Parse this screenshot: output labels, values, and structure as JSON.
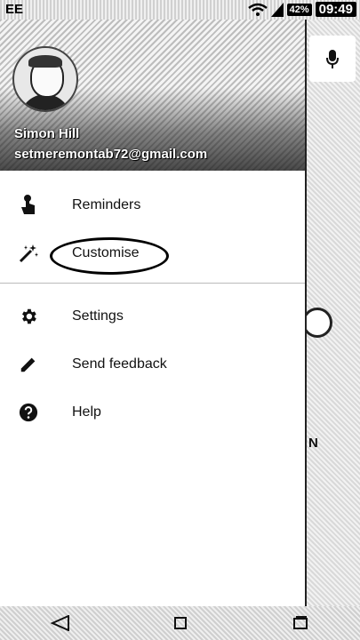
{
  "status_bar": {
    "carrier": "EE",
    "battery": "42%",
    "time": "09:49"
  },
  "account": {
    "name": "Simon Hill",
    "email": "setmeremontab72@gmail.com"
  },
  "menu": {
    "primary": [
      {
        "label": "Reminders",
        "icon": "reminder-hand-icon"
      },
      {
        "label": "Customise",
        "icon": "magic-wand-icon"
      }
    ],
    "secondary": [
      {
        "label": "Settings",
        "icon": "gear-icon"
      },
      {
        "label": "Send feedback",
        "icon": "pencil-icon"
      },
      {
        "label": "Help",
        "icon": "help-circle-icon"
      }
    ]
  },
  "background_app": {
    "letter": "N"
  },
  "colors": {
    "drawer_bg": "#ffffff",
    "text": "#111111",
    "divider": "#bbbbbb"
  }
}
